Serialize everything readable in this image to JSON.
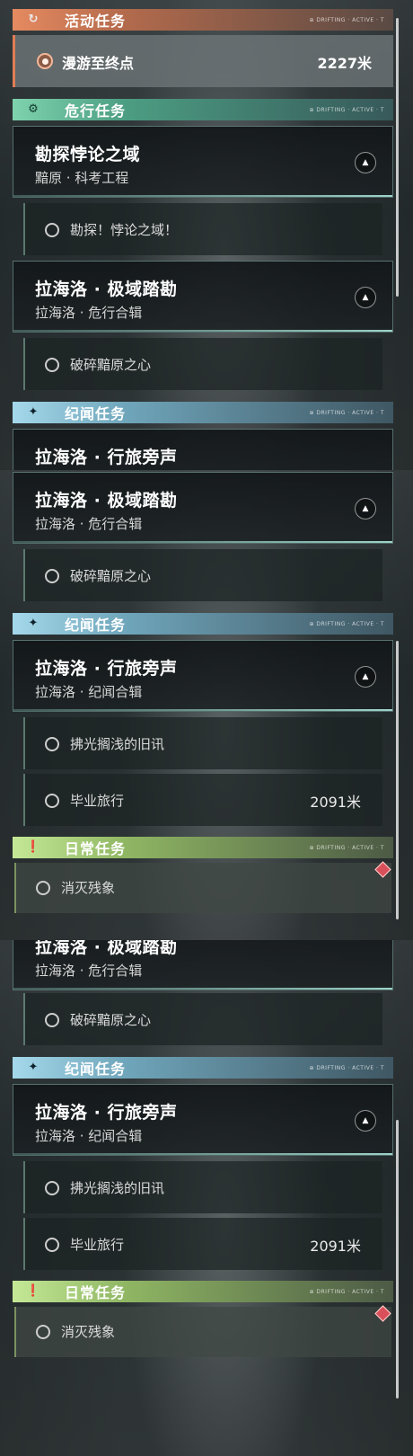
{
  "sections": {
    "active": {
      "title": "活动任务",
      "icon": "refresh-quest-icon",
      "color": "#e68a60",
      "deco": "⊕ DRIFTING · ACTIVE · T"
    },
    "danger": {
      "title": "危行任务",
      "icon": "gear-quest-icon",
      "color": "#7ed3ad",
      "deco": "⊕ DRIFTING · ACTIVE · T"
    },
    "legend": {
      "title": "纪闻任务",
      "icon": "sparkle-quest-icon",
      "color": "#a4d8ea",
      "deco": "⊕ DRIFTING · ACTIVE · T"
    },
    "daily": {
      "title": "日常任务",
      "icon": "exclamation-quest-icon",
      "color": "#c4e896",
      "deco": "⊕ DRIFTING · ACTIVE · T"
    }
  },
  "active_task": {
    "label": "漫游至终点",
    "distance": "2227米"
  },
  "quests": {
    "paradox": {
      "title": "勘探悖论之域",
      "subtitle": "黯原 · 科考工程"
    },
    "extreme": {
      "title": "拉海洛 · 极域踏勘",
      "subtitle": "拉海洛 · 危行合辑"
    },
    "travel": {
      "title": "拉海洛 · 行旅旁声",
      "subtitle": "拉海洛 · 纪闻合辑"
    }
  },
  "tasks": {
    "explore_paradox": "勘探！悖论之域！",
    "shatter_heart": "破碎黯原之心",
    "old_news": "拂光搁浅的旧讯",
    "graduation": "毕业旅行",
    "graduation_distance": "2091米",
    "eliminate": "消灭残象"
  }
}
